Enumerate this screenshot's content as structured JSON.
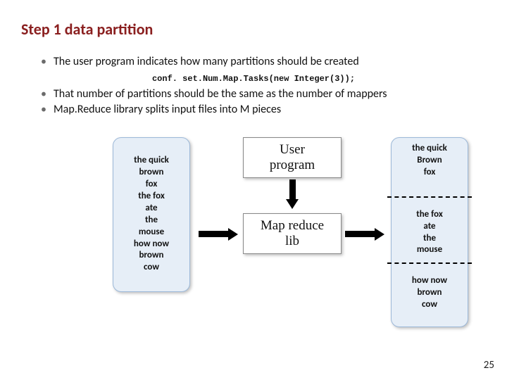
{
  "title": "Step 1 data partition",
  "bullets": {
    "b1": "The user program indicates how many partitions should be created",
    "b2": "That number of partitions should be the same as the number of mappers",
    "b3": "Map.Reduce library splits input files into M pieces"
  },
  "code": "conf. set.Num.Map.Tasks(new Integer(3));",
  "input_lines": {
    "l1": "the quick",
    "l2": "brown",
    "l3": "fox",
    "l4": "the fox",
    "l5": "ate",
    "l6": "the",
    "l7": "mouse",
    "l8": "how now",
    "l9": "brown",
    "l10": "cow"
  },
  "boxes": {
    "user_program": "User\nprogram",
    "mapreduce_lib": "Map reduce\nlib"
  },
  "partitions": {
    "p1": {
      "l1": "the quick",
      "l2": "Brown",
      "l3": "fox"
    },
    "p2": {
      "l1": "the fox",
      "l2": "ate",
      "l3": "the",
      "l4": "mouse"
    },
    "p3": {
      "l1": "how now",
      "l2": "brown",
      "l3": "cow"
    }
  },
  "page_number": "25"
}
